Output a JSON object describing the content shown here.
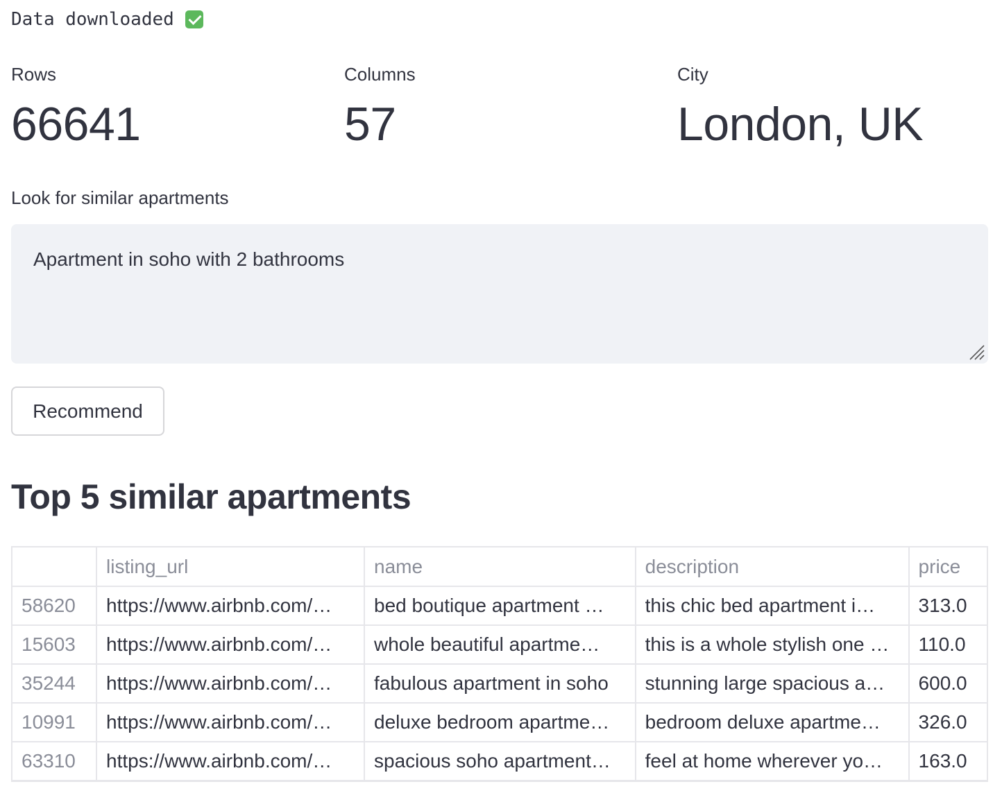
{
  "status": {
    "text": "Data downloaded",
    "icon": "check-mark-icon",
    "icon_color": "#5cb85c"
  },
  "metrics": [
    {
      "label": "Rows",
      "value": "66641"
    },
    {
      "label": "Columns",
      "value": "57"
    },
    {
      "label": "City",
      "value": "London, UK"
    }
  ],
  "search": {
    "label": "Look for similar apartments",
    "value": "Apartment in soho with 2 bathrooms"
  },
  "recommend_button": {
    "label": "Recommend"
  },
  "results": {
    "heading": "Top 5 similar apartments",
    "columns": [
      "",
      "listing_url",
      "name",
      "description",
      "price"
    ],
    "rows": [
      {
        "index": "58620",
        "listing_url": "https://www.airbnb.com/…",
        "name": "bed boutique apartment …",
        "description": "this chic bed apartment i…",
        "price": "313.0"
      },
      {
        "index": "15603",
        "listing_url": "https://www.airbnb.com/…",
        "name": "whole beautiful apartme…",
        "description": "this is a whole stylish one …",
        "price": "110.0"
      },
      {
        "index": "35244",
        "listing_url": "https://www.airbnb.com/…",
        "name": "fabulous apartment in soho",
        "description": "stunning large spacious a…",
        "price": "600.0"
      },
      {
        "index": "10991",
        "listing_url": "https://www.airbnb.com/…",
        "name": "deluxe bedroom apartme…",
        "description": "bedroom deluxe apartme…",
        "price": "326.0"
      },
      {
        "index": "63310",
        "listing_url": "https://www.airbnb.com/…",
        "name": "spacious soho apartment…",
        "description": "feel at home wherever yo…",
        "price": "163.0"
      }
    ]
  },
  "colors": {
    "text": "#31333f",
    "muted": "#8a8d98",
    "input_bg": "#f0f2f6",
    "border": "#e6e6ea"
  }
}
